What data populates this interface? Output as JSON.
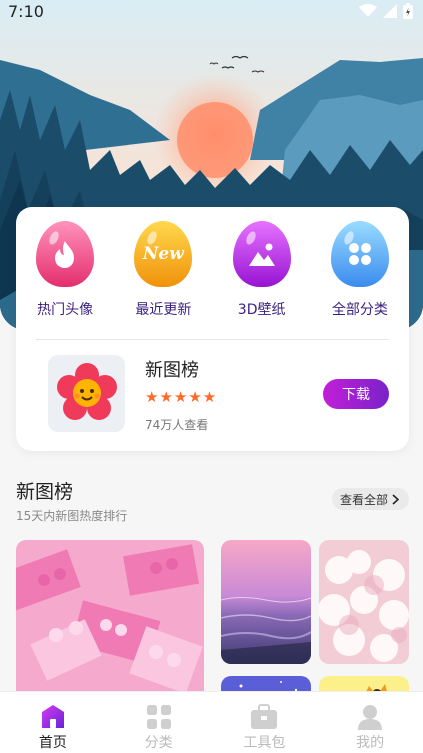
{
  "status_bar": {
    "time": "7:10"
  },
  "quick_links": [
    {
      "label": "热门头像",
      "icon": "flame-icon",
      "color_top": "#ff86b4",
      "color_bottom": "#e8306f"
    },
    {
      "label": "最近更新",
      "icon": "new-badge-icon",
      "badge_text": "New",
      "color_top": "#ffd24a",
      "color_bottom": "#f29a0e"
    },
    {
      "label": "3D壁纸",
      "icon": "image-icon",
      "color_top": "#e36bff",
      "color_bottom": "#9a16d4"
    },
    {
      "label": "全部分类",
      "icon": "grid-icon",
      "color_top": "#8fd8ff",
      "color_bottom": "#3d8ff0"
    }
  ],
  "rank_card": {
    "title": "新图榜",
    "rating": "★★★★★",
    "views": "74万人查看",
    "download_label": "下载"
  },
  "section": {
    "title": "新图榜",
    "subtitle": "15天内新图热度排行",
    "view_all": "查看全部"
  },
  "tabs": [
    {
      "label": "首页",
      "icon": "home-icon",
      "active": true
    },
    {
      "label": "分类",
      "icon": "category-icon",
      "active": false
    },
    {
      "label": "工具包",
      "icon": "toolbox-icon",
      "active": false
    },
    {
      "label": "我的",
      "icon": "profile-icon",
      "active": false
    }
  ],
  "colors": {
    "accent": "#8a22d0",
    "star": "#ff6a2a"
  }
}
